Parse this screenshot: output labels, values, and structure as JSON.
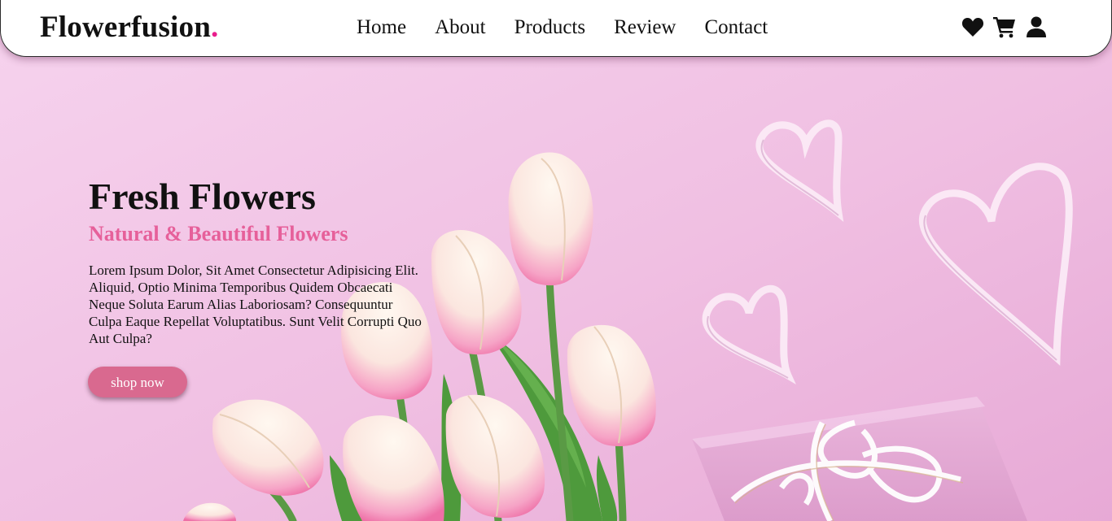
{
  "brand": {
    "name": "Flowerfusion",
    "dot": ".",
    "accent_color": "#e91e8c"
  },
  "nav": {
    "links": [
      "Home",
      "About",
      "Products",
      "Review",
      "Contact"
    ],
    "icons": [
      "heart-icon",
      "cart-icon",
      "user-icon"
    ]
  },
  "hero": {
    "title": "Fresh Flowers",
    "subtitle": "Natural & Beautiful Flowers",
    "subtitle_color": "#e6609a",
    "body": "Lorem Ipsum Dolor, Sit Amet Consectetur Adipisicing Elit. Aliquid, Optio Minima Temporibus Quidem Obcaecati Neque Soluta Earum Alias Laboriosam? Consequuntur Culpa Eaque Repellat Voluptatibus. Sunt Velit Corrupti Quo Aut Culpa?",
    "cta_label": "shop now",
    "cta_color": "#d9698f",
    "background_color": "#f3c9e6"
  }
}
